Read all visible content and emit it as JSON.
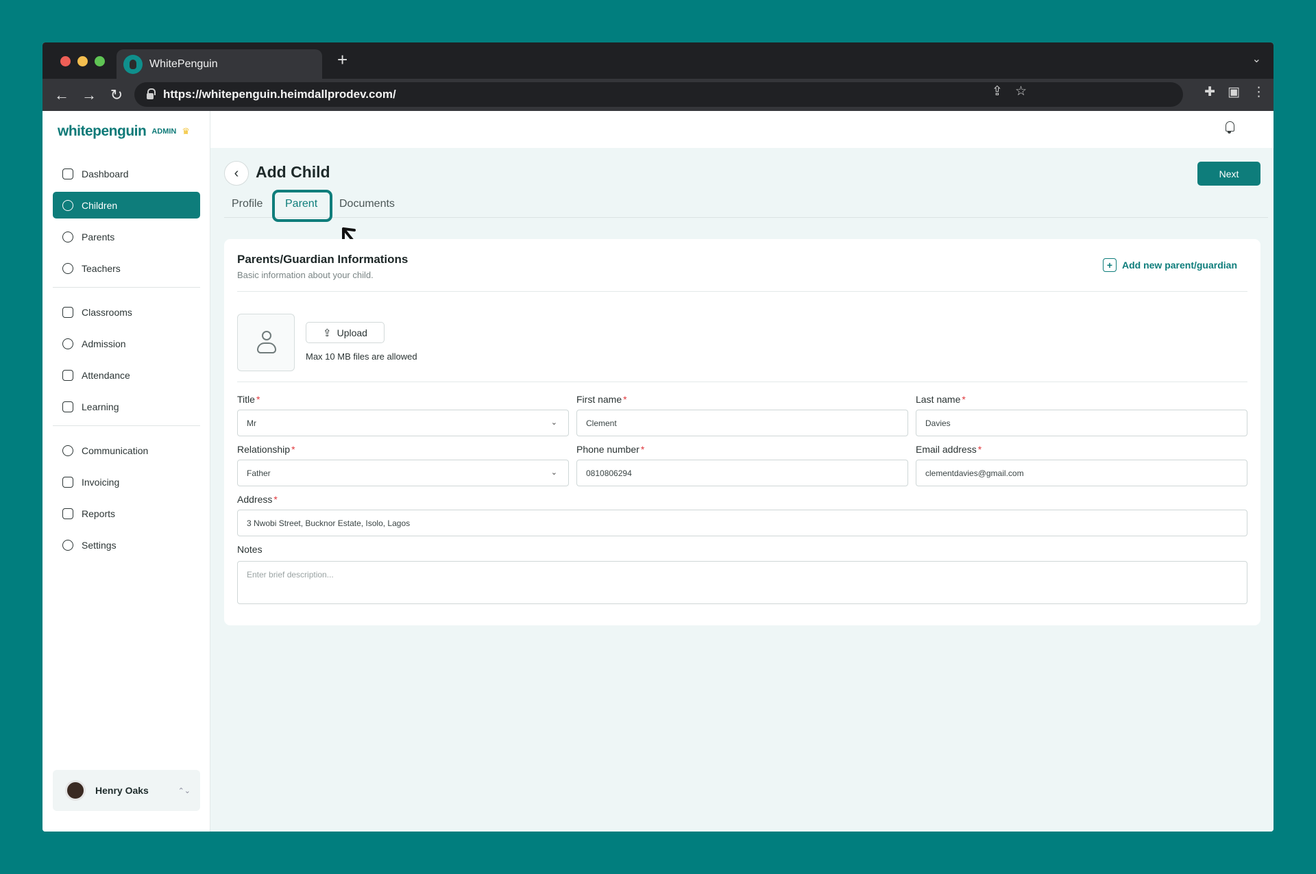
{
  "browser": {
    "tab_title": "WhitePenguin",
    "new_tab": "+",
    "url": "https://whitepenguin.heimdallprodev.com/",
    "traffic_lights": [
      "#ee5f57",
      "#f4be4f",
      "#5fc454"
    ]
  },
  "brand": {
    "logo": "whitepenguin",
    "badge": "ADMIN",
    "accent": "#0e7d7b"
  },
  "sidebar": {
    "groups": [
      [
        {
          "label": "Dashboard",
          "icon": "home-icon"
        },
        {
          "label": "Children",
          "icon": "children-icon",
          "active": true
        },
        {
          "label": "Parents",
          "icon": "parents-icon"
        },
        {
          "label": "Teachers",
          "icon": "teachers-icon"
        }
      ],
      [
        {
          "label": "Classrooms",
          "icon": "classrooms-icon"
        },
        {
          "label": "Admission",
          "icon": "admission-icon"
        },
        {
          "label": "Attendance",
          "icon": "attendance-icon"
        },
        {
          "label": "Learning",
          "icon": "learning-icon"
        }
      ],
      [
        {
          "label": "Communication",
          "icon": "communication-icon"
        },
        {
          "label": "Invoicing",
          "icon": "invoicing-icon"
        },
        {
          "label": "Reports",
          "icon": "reports-icon"
        },
        {
          "label": "Settings",
          "icon": "settings-icon"
        }
      ]
    ],
    "user": {
      "name": "Henry Oaks"
    }
  },
  "header": {
    "title": "Add Child",
    "next_label": "Next",
    "tabs": [
      {
        "label": "Profile"
      },
      {
        "label": "Parent",
        "active": true
      },
      {
        "label": "Documents"
      }
    ]
  },
  "card": {
    "title": "Parents/Guardian Informations",
    "subtitle": "Basic information about your child.",
    "add_parent_label": "Add new parent/guardian",
    "upload_label": "Upload",
    "upload_note": "Max 10 MB files are allowed"
  },
  "form": {
    "title": {
      "label": "Title",
      "value": "Mr"
    },
    "first_name": {
      "label": "First name",
      "value": "Clement"
    },
    "last_name": {
      "label": "Last name",
      "value": "Davies"
    },
    "relationship": {
      "label": "Relationship",
      "value": "Father"
    },
    "phone": {
      "label": "Phone number",
      "value": "0810806294"
    },
    "email": {
      "label": "Email address",
      "value": "clementdavies@gmail.com"
    },
    "address": {
      "label": "Address",
      "value": "3 Nwobi Street, Bucknor Estate, Isolo, Lagos"
    },
    "notes": {
      "label": "Notes",
      "placeholder": "Enter brief description..."
    }
  }
}
